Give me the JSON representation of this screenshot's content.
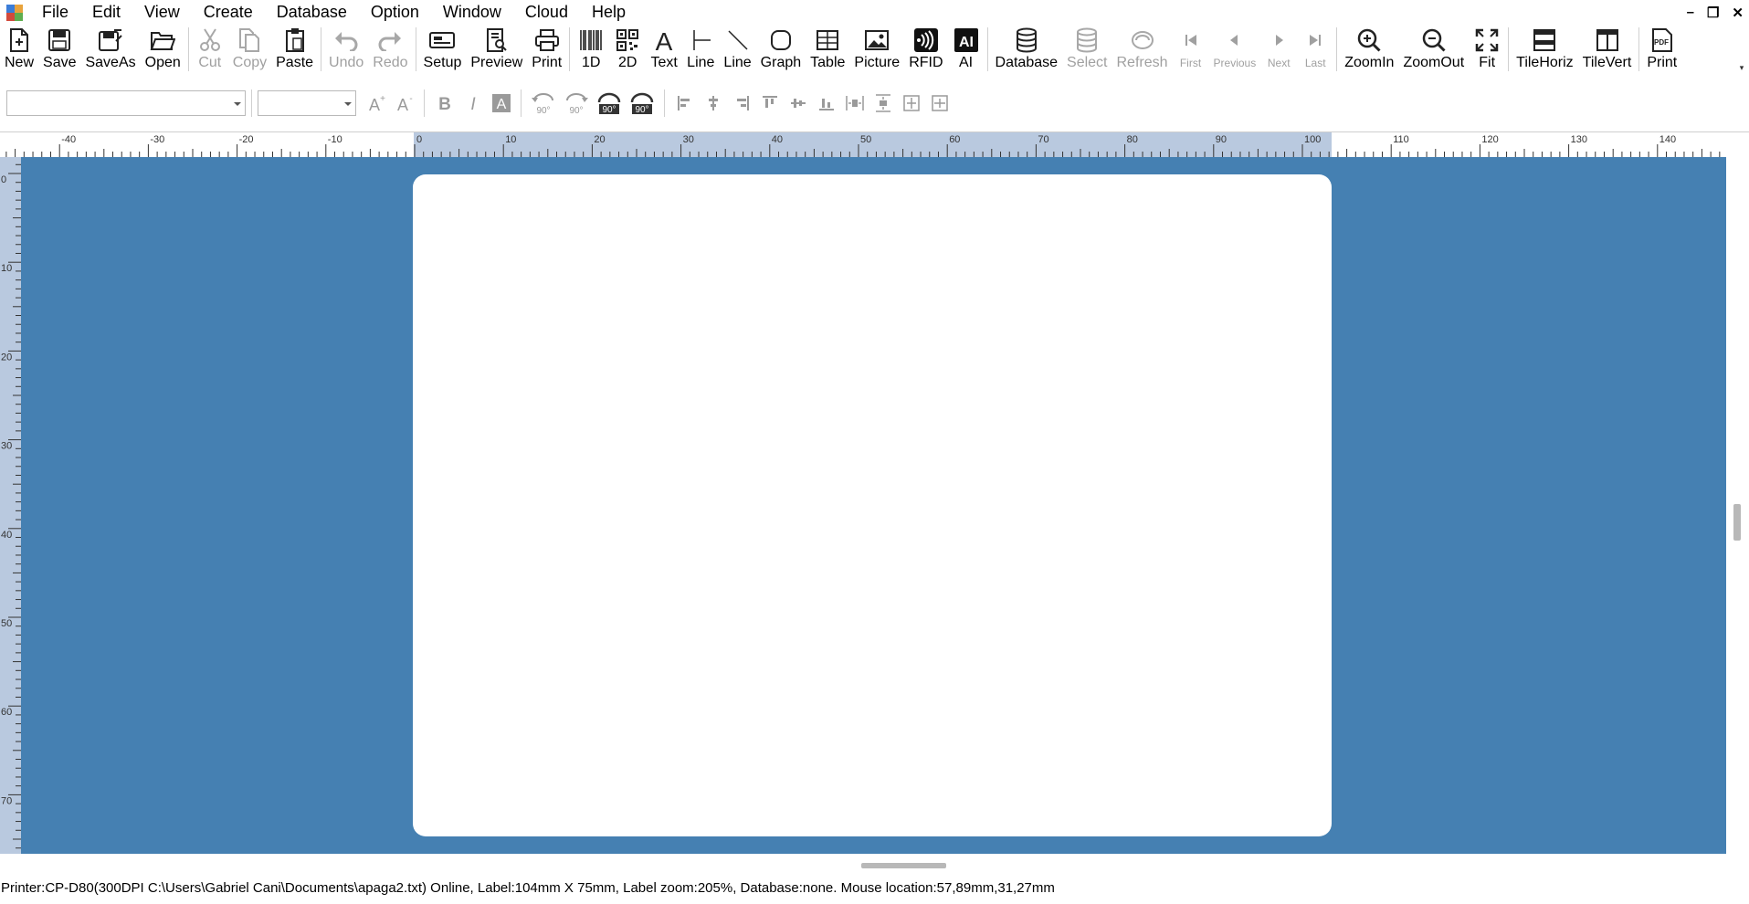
{
  "menu": {
    "items": [
      "File",
      "Edit",
      "View",
      "Create",
      "Database",
      "Option",
      "Window",
      "Cloud",
      "Help"
    ]
  },
  "window_controls": {
    "minimize": "–",
    "restore": "❐",
    "close": "✕"
  },
  "toolbar": {
    "new": "New",
    "save": "Save",
    "saveas": "SaveAs",
    "open": "Open",
    "cut": "Cut",
    "copy": "Copy",
    "paste": "Paste",
    "undo": "Undo",
    "redo": "Redo",
    "setup": "Setup",
    "preview": "Preview",
    "print": "Print",
    "barcode1d": "1D",
    "barcode2d": "2D",
    "text": "Text",
    "line1": "Line",
    "line2": "Line",
    "graph": "Graph",
    "table": "Table",
    "picture": "Picture",
    "rfid": "RFID",
    "ai": "AI",
    "database": "Database",
    "select": "Select",
    "refresh": "Refresh",
    "first": "First",
    "previous": "Previous",
    "next": "Next",
    "last": "Last",
    "zoomin": "ZoomIn",
    "zoomout": "ZoomOut",
    "fit": "Fit",
    "tilehoriz": "TileHoriz",
    "tilevert": "TileVert",
    "printpdf": "Print"
  },
  "format_toolbar": {
    "font_family_value": "",
    "font_size_value": "",
    "rotate_labels": [
      "90°",
      "90°",
      "90°",
      "90°"
    ]
  },
  "ruler": {
    "h_labels": [
      "-40",
      "-30",
      "-20",
      "-10",
      "0",
      "10",
      "20",
      "30",
      "40",
      "50",
      "60",
      "70",
      "80",
      "90",
      "100",
      "110",
      "120",
      "130",
      "140"
    ],
    "v_labels": [
      "0",
      "10",
      "20",
      "30",
      "40",
      "50",
      "60",
      "70"
    ]
  },
  "status": {
    "text": "Printer:CP-D80(300DPI C:\\Users\\Gabriel Cani\\Documents\\apaga2.txt) Online, Label:104mm X 75mm, Label zoom:205%, Database:none.  Mouse location:57,89mm,31,27mm"
  },
  "colors": {
    "canvas": "#4580b2",
    "label": "#ffffff",
    "ruler_highlight": "#b9c9df"
  }
}
